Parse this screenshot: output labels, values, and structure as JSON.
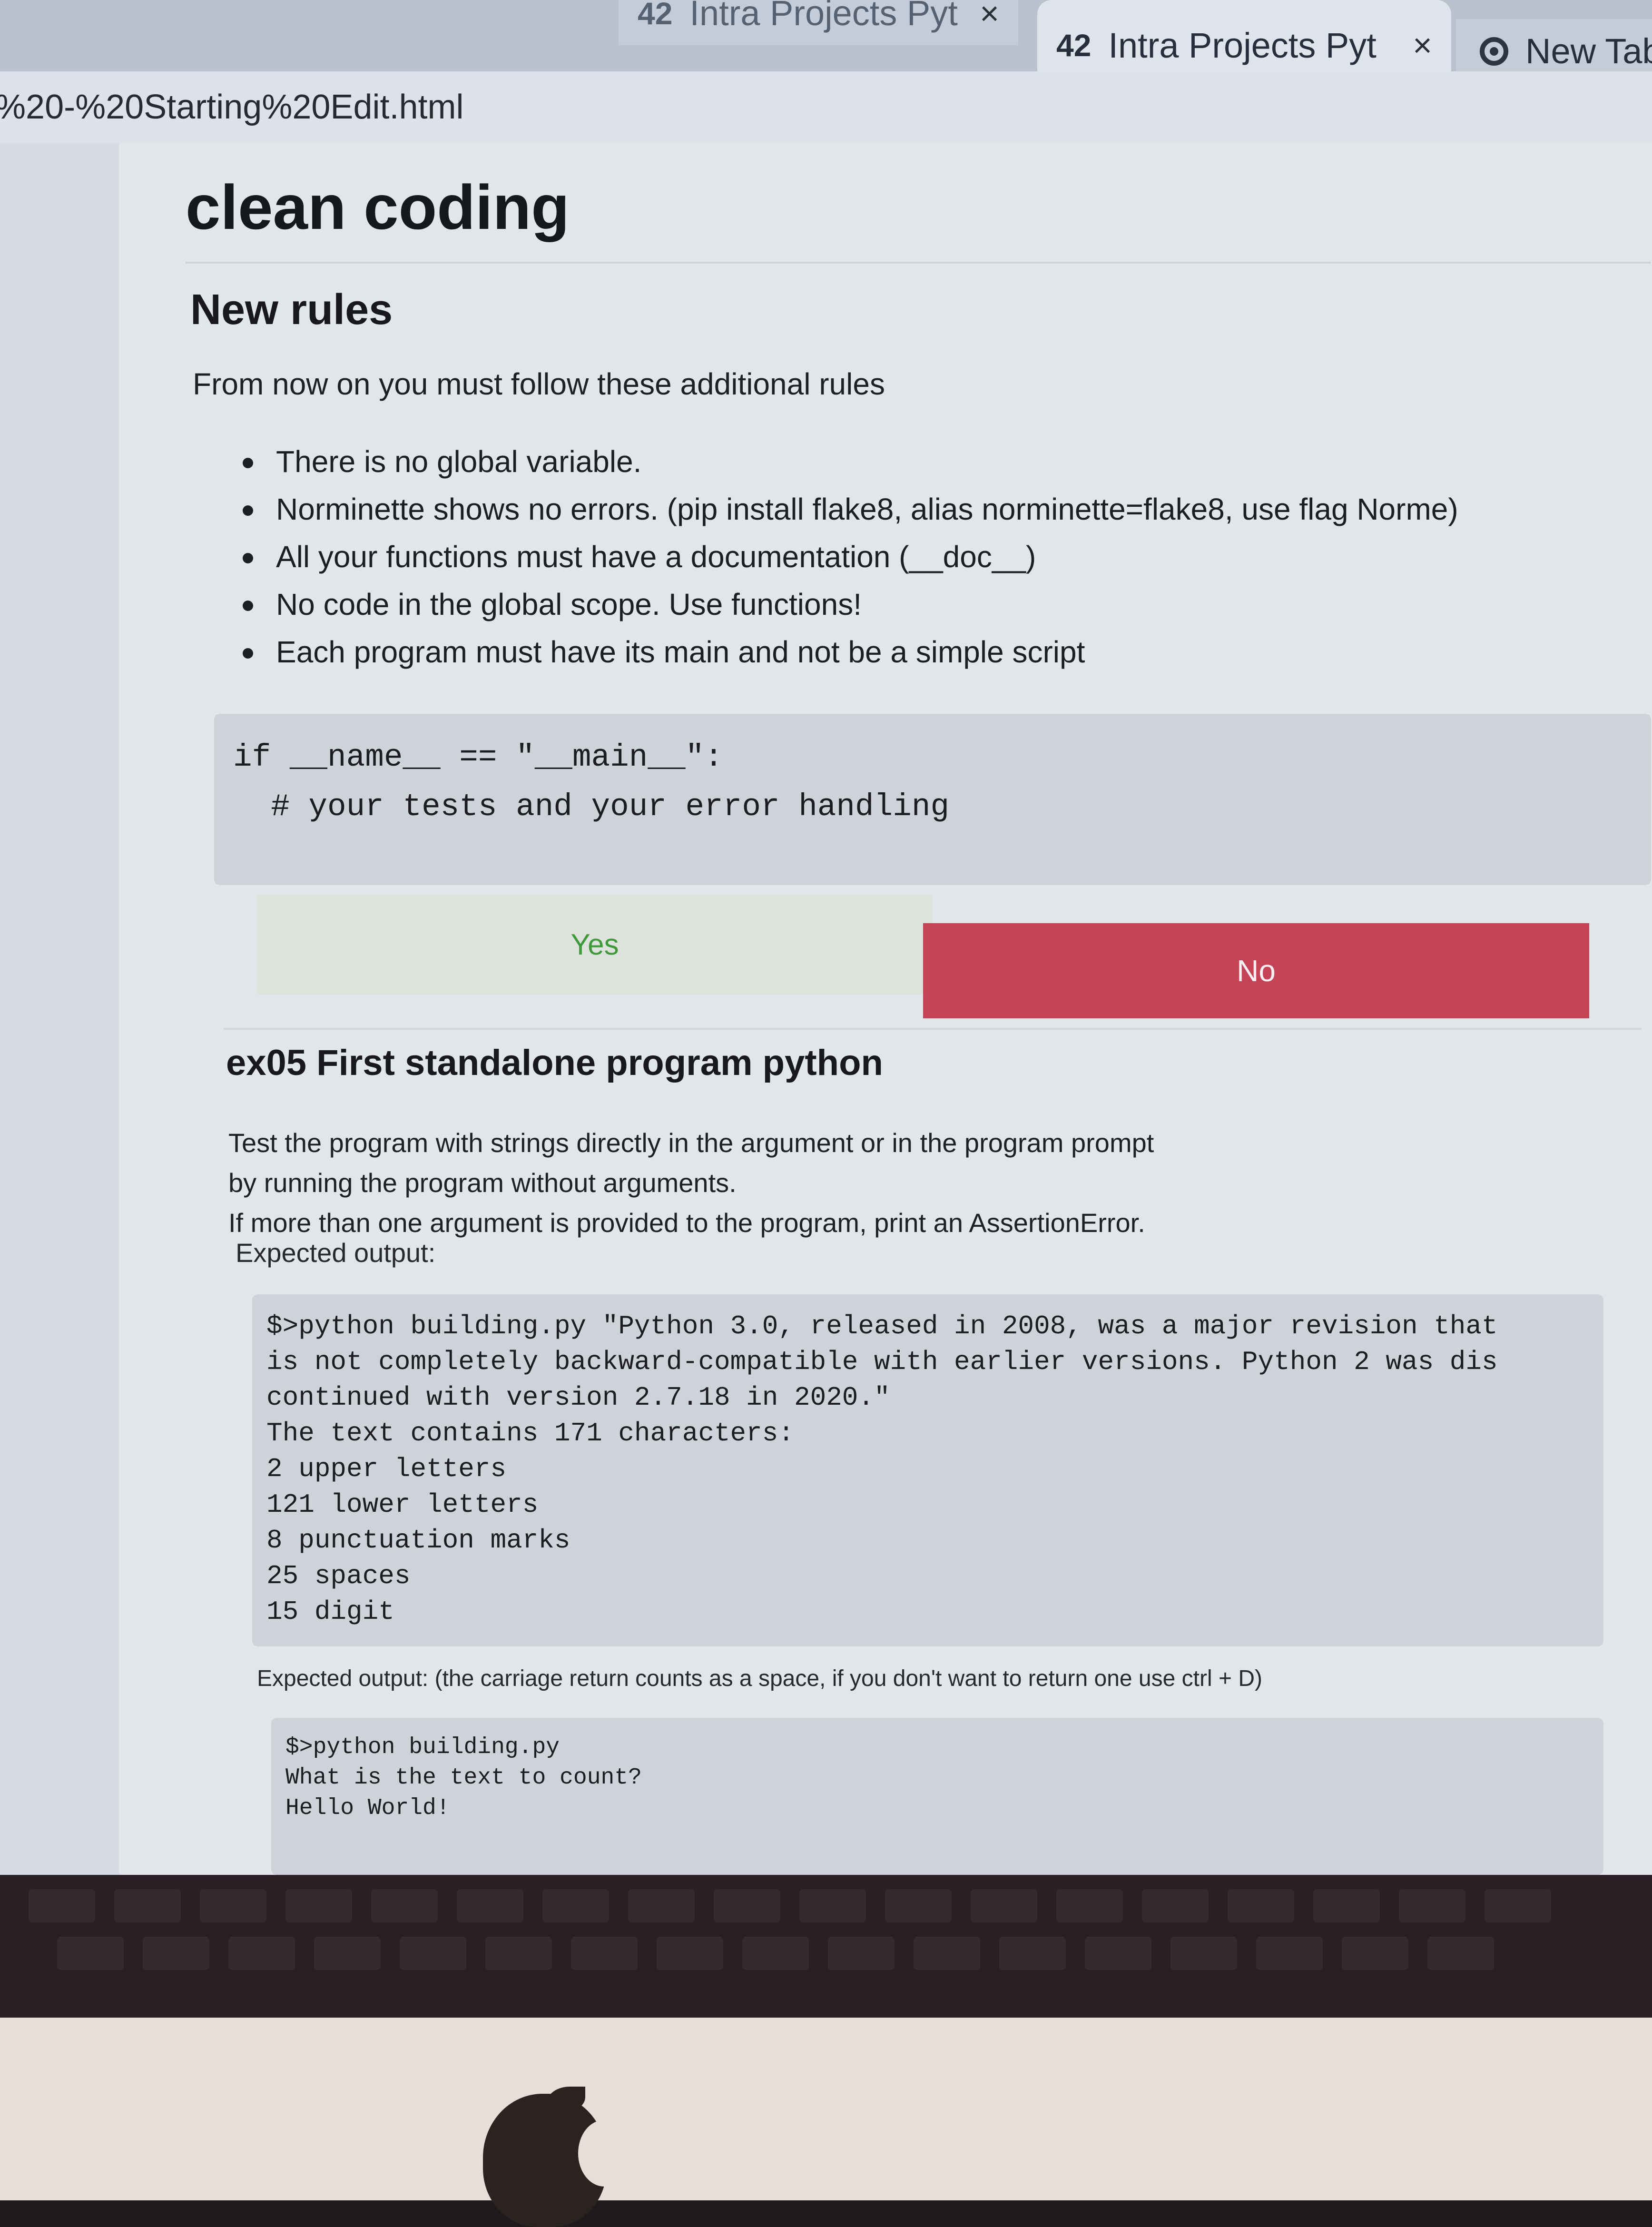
{
  "browser": {
    "tabs": [
      {
        "logo": "42",
        "label": "Intra Projects Pyt",
        "close": "×"
      },
      {
        "logo": "42",
        "label": "Intra Projects Pyt",
        "close": "×"
      },
      {
        "label": "New Tab"
      }
    ],
    "url": "%20-%20Starting%20Edit.html"
  },
  "page": {
    "title": "clean coding",
    "section_title": "New rules",
    "intro": "From now on you must follow these additional rules",
    "rules": [
      "There is no global variable.",
      "Norminette shows no errors. (pip install flake8, alias norminette=flake8, use flag Norme)",
      "All your functions must have a documentation (__doc__)",
      "No code in the global scope. Use functions!",
      "Each program must have its main and not be a simple script"
    ],
    "main_code": [
      "if __name__ == \"__main__\":",
      "  # your tests and your error handling"
    ],
    "yes_label": "Yes",
    "no_label": "No",
    "exercise_title": "ex05 First standalone program python",
    "exercise_desc": [
      "Test the program with strings directly in the argument or in the program prompt",
      "by running the program without arguments.",
      "If more than one argument is provided to the program, print an AssertionError."
    ],
    "expected_label": "Expected output:",
    "expected_code": [
      "$>python building.py \"Python 3.0, released in 2008, was a major revision that",
      "is not completely backward-compatible with earlier versions. Python 2 was dis",
      "continued with version 2.7.18 in 2020.\"",
      "The text contains 171 characters:",
      "2 upper letters",
      "121 lower letters",
      "8 punctuation marks",
      "25 spaces",
      "15 digit"
    ],
    "expected_label2": "Expected output: (the carriage return counts as a space, if you don't want to return one use ctrl + D)",
    "expected_code2": [
      "$>python building.py",
      "What is the text to count?",
      "Hello World!"
    ]
  }
}
